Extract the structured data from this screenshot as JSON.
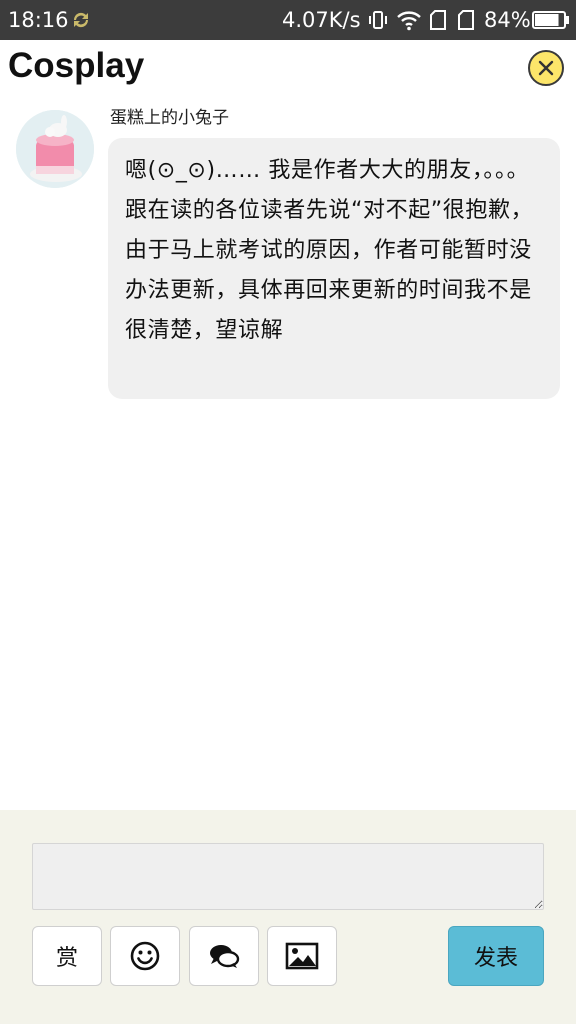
{
  "status_bar": {
    "time": "18:16",
    "net_speed": "4.07K/s",
    "battery_percent": "84%",
    "battery_level": 0.84,
    "icons": [
      "sync-icon",
      "vibrate-icon",
      "wifi-icon",
      "sim1-icon",
      "sim2-icon",
      "battery-icon"
    ]
  },
  "header": {
    "title": "Cosplay",
    "close_icon": "close-icon"
  },
  "message": {
    "sender": "蛋糕上的小兔子",
    "avatar_icon": "avatar",
    "text": "嗯(⊙_⊙)…… 我是作者大大的朋友，。。。跟在读的各位读者先说“对不起”很抱歉，由于马上就考试的原因，作者可能暂时没办法更新，具体再回来更新的时间我不是很清楚，望谅解"
  },
  "composer": {
    "input_value": "",
    "reward_label": "赏",
    "emoji_icon": "smiley-icon",
    "comment_icon": "chat-bubbles-icon",
    "image_icon": "image-icon",
    "send_label": "发表"
  },
  "colors": {
    "status_bar_bg": "#3c3c3c",
    "close_button": "#fde66a",
    "bubble_bg": "#f0f0f0",
    "panel_bg": "#f3f3ea",
    "send_button": "#5bbcd6"
  }
}
